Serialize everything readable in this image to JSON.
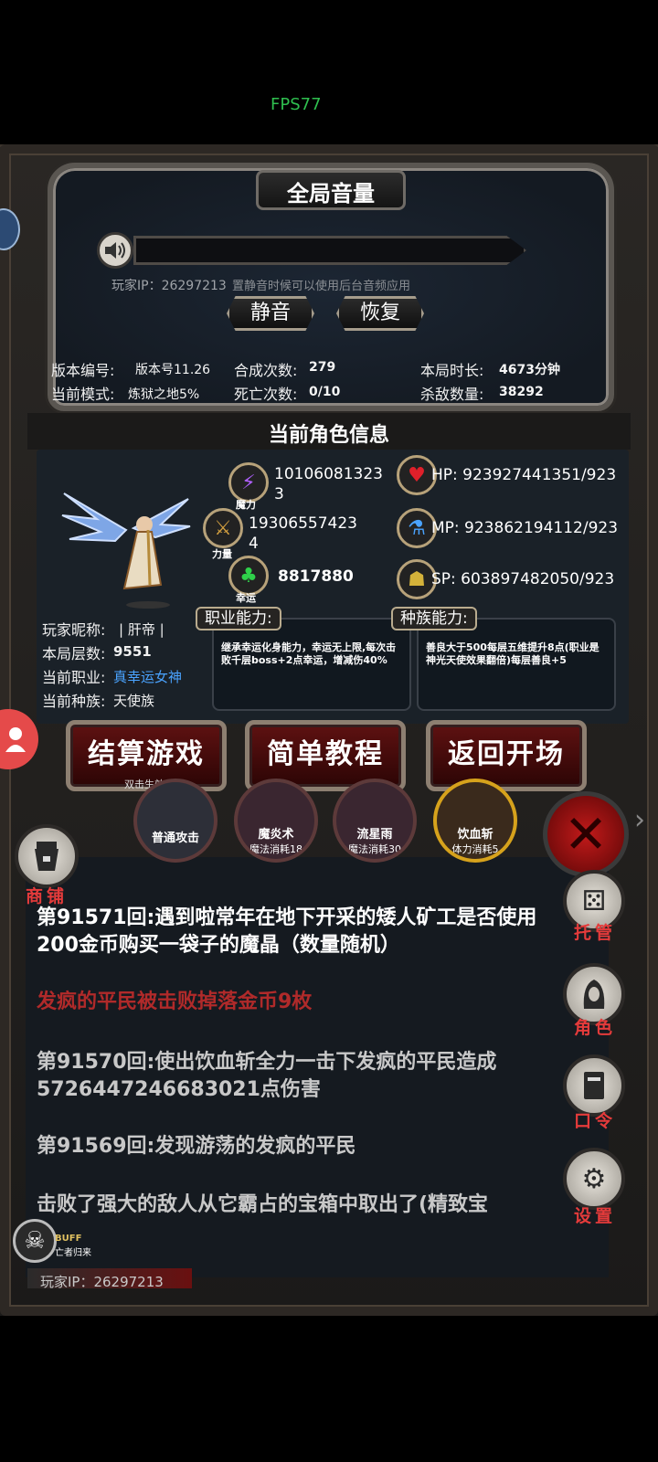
{
  "fps": "FPS77",
  "volume_panel": {
    "title": "全局音量",
    "ip_line": "玩家IP：26297213",
    "tip": "置静音时候可以使用后台音频应用",
    "mute_label": "静音",
    "restore_label": "恢复"
  },
  "stats": {
    "version_label": "版本编号:",
    "version_value": "版本号11.26",
    "mode_label": "当前模式:",
    "mode_value": "炼狱之地5%",
    "craft_label": "合成次数:",
    "craft_value": "279",
    "death_label": "死亡次数:",
    "death_value": "0/10",
    "duration_label": "本局时长:",
    "duration_value": "4673分钟",
    "kills_label": "杀敌数量:",
    "kills_value": "38292"
  },
  "character": {
    "section_title": "当前角色信息",
    "magic_sub": "魔力",
    "magic_value": "10106081323\n3",
    "power_sub": "力量",
    "power_value": "19306557423\n4",
    "luck_sub": "幸运",
    "luck_value": "8817880",
    "hp": "HP:  923927441351/923",
    "mp": "MP:  923862194112/923",
    "sp": "SP:  603897482050/923",
    "job_ability_label": "职业能力:",
    "job_ability_text": "继承幸运化身能力，幸运无上限,每次击败千层boss+2点幸运，增减伤40%",
    "race_ability_label": "种族能力:",
    "race_ability_text": "善良大于500每层五维提升8点(职业是神光天使效果翻倍)每层善良+5",
    "nickname_label": "玩家昵称:",
    "nickname_value": "| 肝帝 |",
    "floor_label": "本局层数:",
    "floor_value": "9551",
    "job_label": "当前职业:",
    "job_value": "真幸运女神",
    "race_label": "当前种族:",
    "race_value": "天使族"
  },
  "buttons": {
    "settle": "结算游戏",
    "settle_hint": "双击生效",
    "tutorial": "简单教程",
    "return": "返回开场"
  },
  "skills": [
    {
      "name": "普通攻击",
      "cost": ""
    },
    {
      "name": "魔炎术",
      "cost": "魔法消耗18"
    },
    {
      "name": "流星雨",
      "cost": "魔法消耗30"
    },
    {
      "name": "饮血斩",
      "cost": "体力消耗5"
    }
  ],
  "shop_label": "商铺",
  "side": {
    "auto": "托管",
    "role": "角色",
    "code": "口令",
    "settings": "设置"
  },
  "log": [
    {
      "text": "第91571回:遇到啦常年在地下开采的矮人矿工是否使用200金币购买一袋子的魔晶（数量随机）",
      "color": "#ffffff"
    },
    {
      "text": "发疯的平民被击败掉落金币9枚",
      "color": "#b02a2a"
    },
    {
      "text": "第91570回:使出饮血斩全力一击下发疯的平民造成5726447246683021点伤害",
      "color": "#c8c8c8"
    },
    {
      "text": "第91569回:发现游荡的发疯的平民",
      "color": "#c8c8c8"
    },
    {
      "text": "击败了强大的敌人从它霸占的宝箱中取出了(精致宝",
      "color": "#c8c8c8"
    }
  ],
  "buff": {
    "title": "BUFF",
    "sub": "亡者归来"
  },
  "footer_ip": "玩家IP：26297213",
  "colors": {
    "accent_red": "#e43b3b",
    "fps_green": "#2fbf4f",
    "job_blue": "#4aa3ff"
  }
}
